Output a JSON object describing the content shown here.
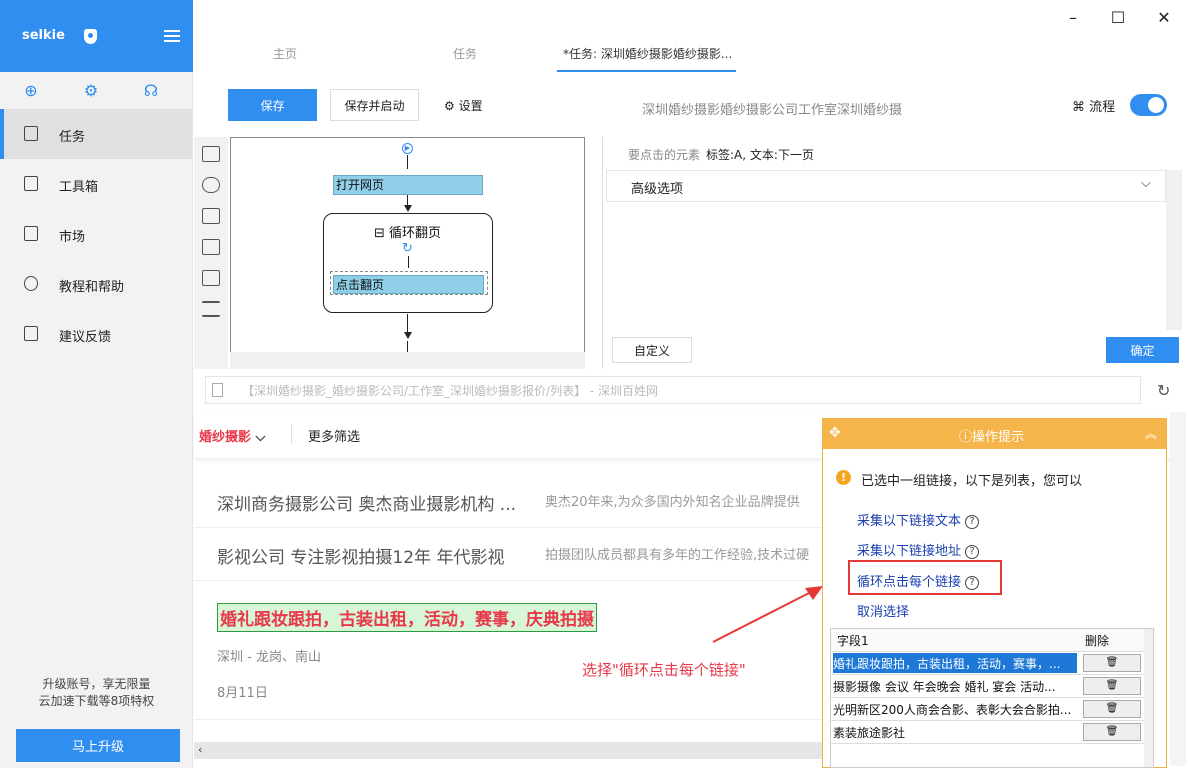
{
  "app": {
    "name": "selkie"
  },
  "sidebar": {
    "items": [
      {
        "label": "任务"
      },
      {
        "label": "工具箱"
      },
      {
        "label": "市场"
      },
      {
        "label": "教程和帮助"
      },
      {
        "label": "建议反馈"
      }
    ],
    "upgrade_line1": "升级账号，享无限量",
    "upgrade_line2": "云加速下载等8项特权",
    "upgrade_button": "马上升级"
  },
  "tabs": [
    {
      "label": "主页"
    },
    {
      "label": "任务"
    },
    {
      "label": "*任务: 深圳婚纱摄影婚纱摄影..."
    }
  ],
  "toolbar": {
    "save_label": "保存",
    "save_start_label": "保存并启动",
    "settings_label": "设置",
    "task_title": "深圳婚纱摄影婚纱摄影公司工作室深圳婚纱摄",
    "flow_label": "流程"
  },
  "flow": {
    "open_page": "打开网页",
    "loop_label": "循环翻页",
    "click_page": "点击翻页"
  },
  "options": {
    "element_label": "要点击的元素",
    "element_value": "标签:A, 文本:下一页",
    "advanced_label": "高级选项",
    "custom_button": "自定义",
    "confirm_button": "确定"
  },
  "browser": {
    "url": "【深圳婚纱摄影_婚纱摄影公司/工作室_深圳婚纱摄影报价/列表】 - 深圳百姓网",
    "filter_category": "婚纱摄影",
    "filter_more": "更多筛选",
    "listings": [
      {
        "title": "深圳商务摄影公司 奥杰商业摄影机构 ...",
        "desc": "奥杰20年来,为众多国内外知名企业品牌提供"
      },
      {
        "title": "影视公司 专注影视拍摄12年 年代影视",
        "desc": "拍摄团队成员都具有多年的工作经验,技术过硬"
      }
    ],
    "highlight_title": "婚礼跟妆跟拍，古装出租，活动，赛事，庆典拍摄",
    "location": "深圳 - 龙岗、南山",
    "date": "8月11日",
    "annotation": "选择\"循环点击每个链接\""
  },
  "tips": {
    "title": "操作提示",
    "message": "已选中一组链接，以下是列表，您可以",
    "options": [
      {
        "label": "采集以下链接文本"
      },
      {
        "label": "采集以下链接地址"
      },
      {
        "label": "循环点击每个链接"
      },
      {
        "label": "取消选择"
      }
    ],
    "table_header": {
      "field": "字段1",
      "delete": "删除"
    },
    "rows": [
      {
        "text": "婚礼跟妆跟拍，古装出租，活动，赛事，..."
      },
      {
        "text": "摄影摄像  会议  年会晚会  婚礼  宴会  活动..."
      },
      {
        "text": "光明新区200人商会合影、表彰大会合影拍..."
      },
      {
        "text": "素装旅途影社"
      }
    ]
  }
}
